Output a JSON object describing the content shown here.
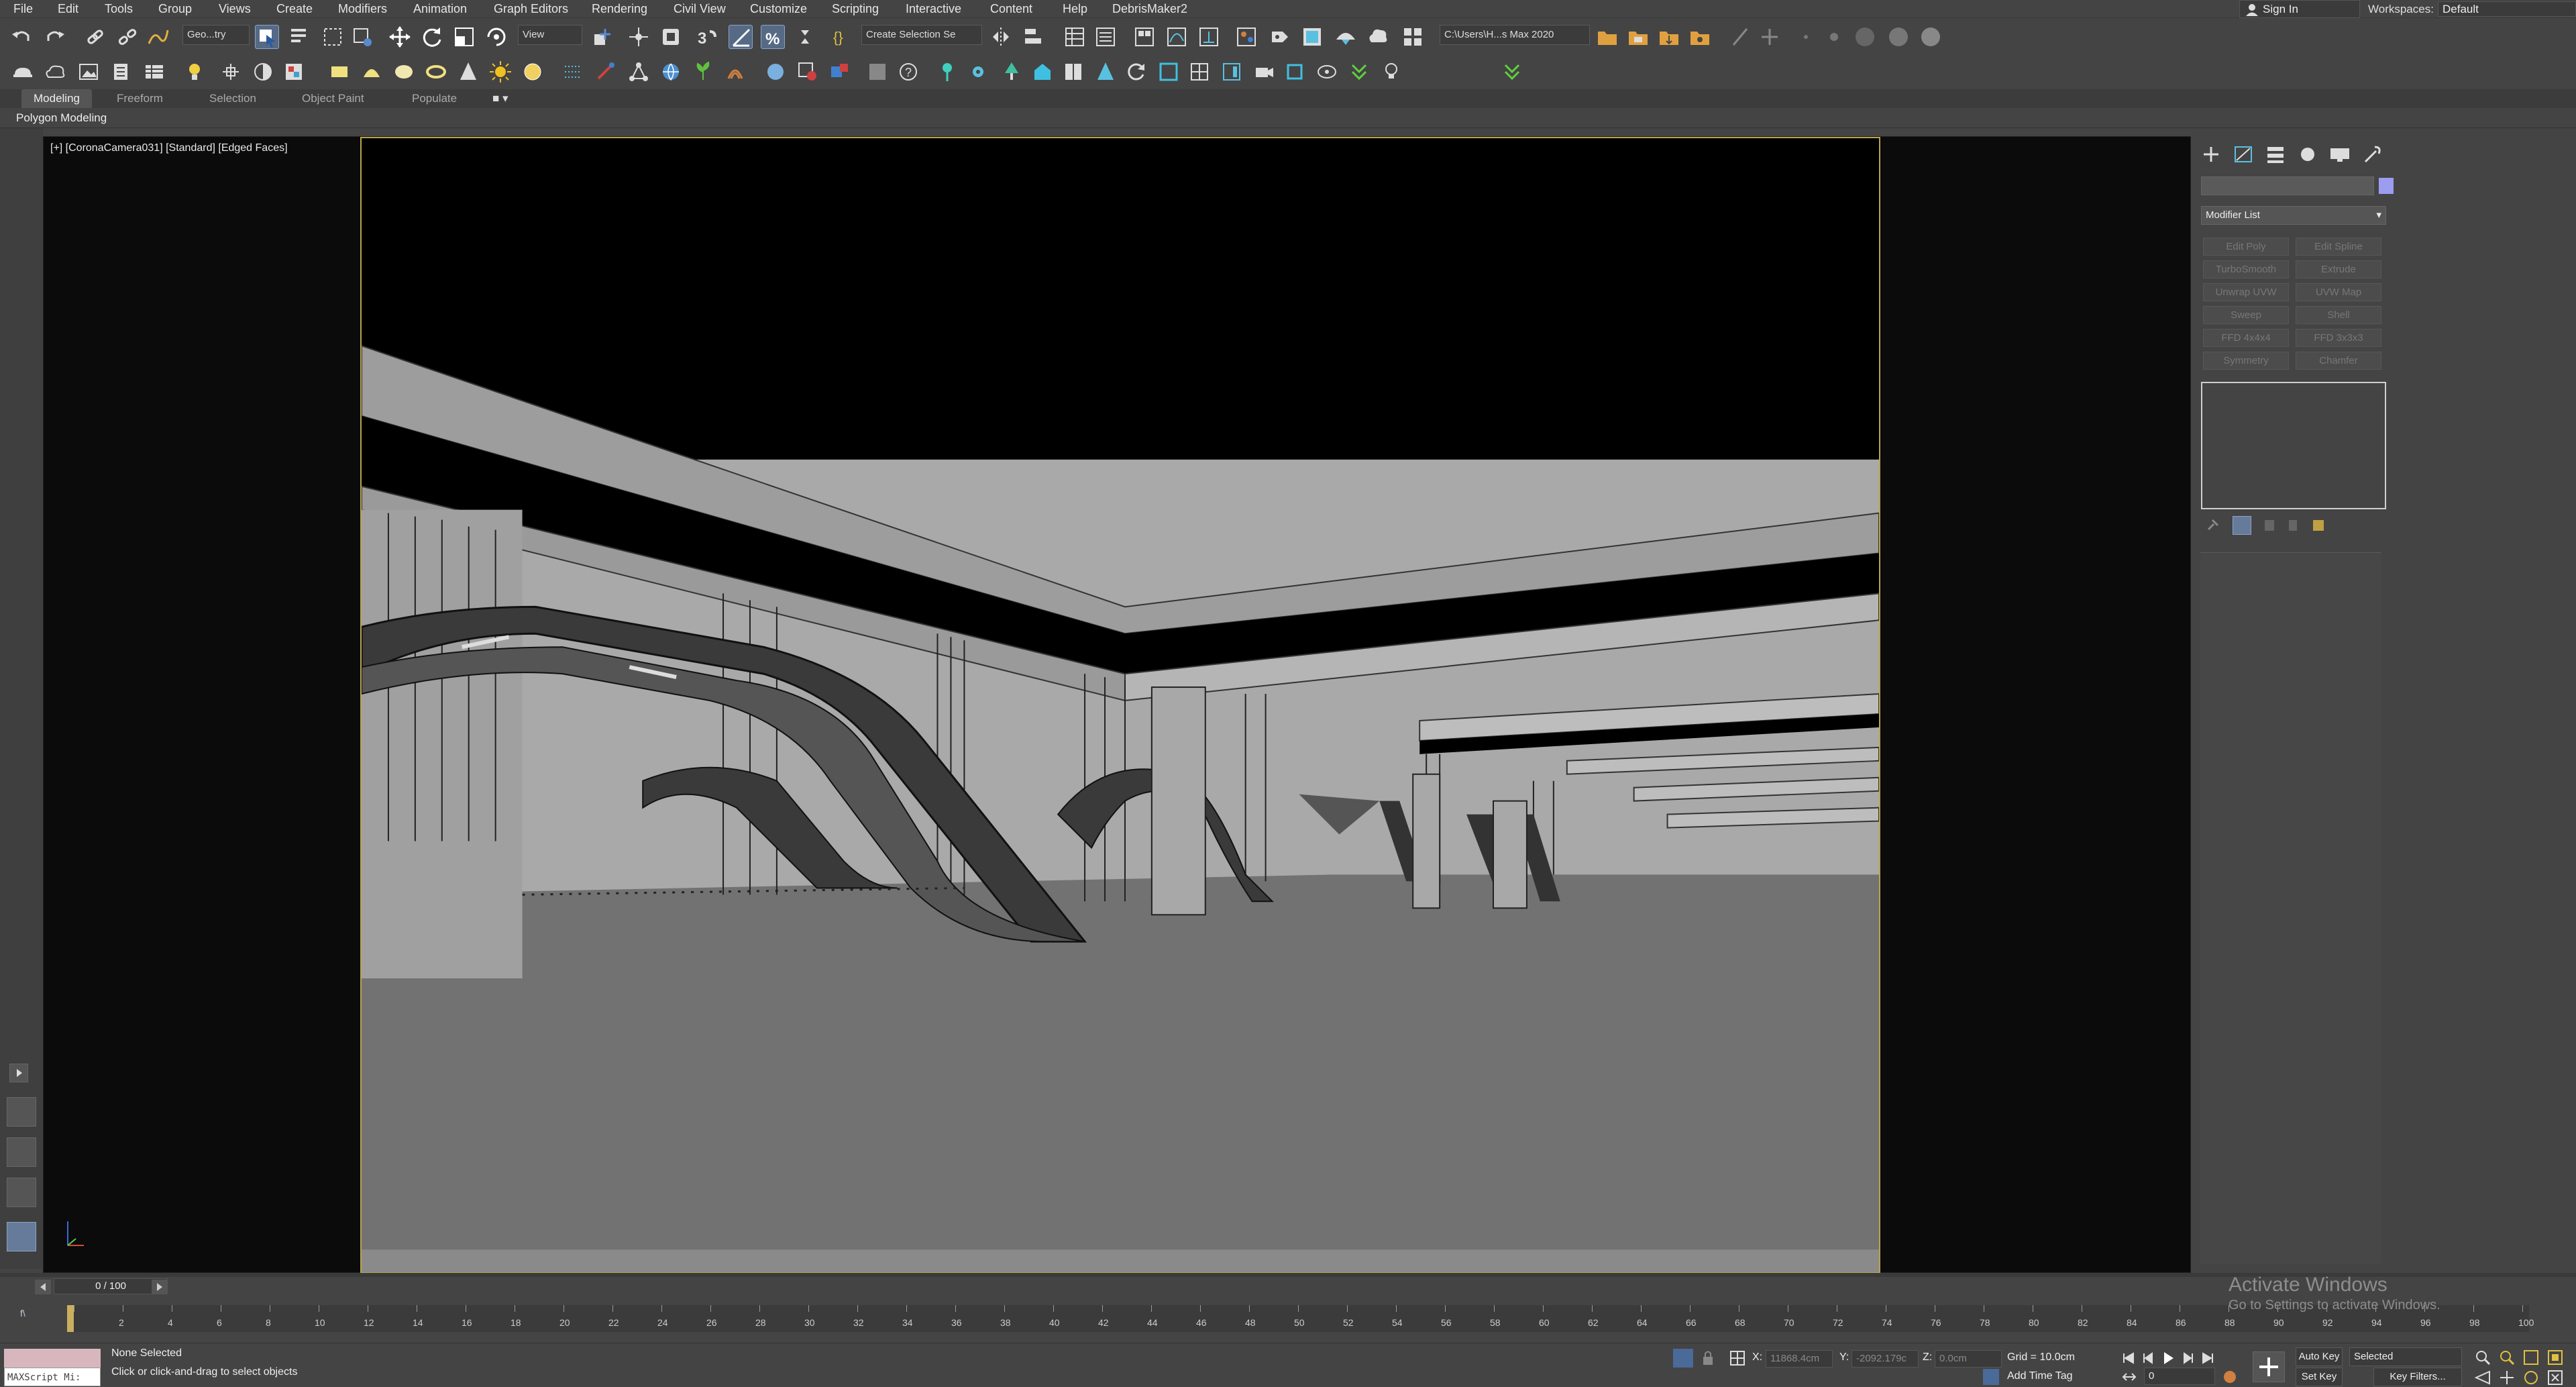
{
  "menubar": {
    "items": [
      "File",
      "Edit",
      "Tools",
      "Group",
      "Views",
      "Create",
      "Modifiers",
      "Animation",
      "Graph Editors",
      "Rendering",
      "Civil View",
      "Customize",
      "Scripting",
      "Interactive",
      "Content",
      "Help",
      "DebrisMaker2"
    ],
    "sign_in": "Sign In",
    "workspaces_label": "Workspaces:",
    "workspaces_value": "Default"
  },
  "toolbar": {
    "selection_filter": "Geo...try",
    "reference_coord": "View",
    "named_selection": "Create Selection Se",
    "project_path": "C:\\Users\\H...s Max 2020"
  },
  "ribbon": {
    "tabs": [
      "Modeling",
      "Freeform",
      "Selection",
      "Object Paint",
      "Populate"
    ],
    "sub_label": "Polygon Modeling"
  },
  "viewport": {
    "label": "[+] [CoronaCamera031] [Standard] [Edged Faces]"
  },
  "command_panel": {
    "modifier_list": "Modifier List",
    "buttons": [
      "Edit Poly",
      "Edit Spline",
      "TurboSmooth",
      "Extrude",
      "Unwrap UVW",
      "UVW Map",
      "Sweep",
      "Shell",
      "FFD 4x4x4",
      "FFD 3x3x3",
      "Symmetry",
      "Chamfer"
    ],
    "color_swatch": "#9c9cf0"
  },
  "timeline": {
    "slider_text": "0 / 100",
    "ticks": [
      "0",
      "2",
      "4",
      "6",
      "8",
      "10",
      "12",
      "14",
      "16",
      "18",
      "20",
      "22",
      "24",
      "26",
      "28",
      "30",
      "32",
      "34",
      "36",
      "38",
      "40",
      "42",
      "44",
      "46",
      "48",
      "50",
      "52",
      "54",
      "56",
      "58",
      "60",
      "62",
      "64",
      "66",
      "68",
      "70",
      "72",
      "74",
      "76",
      "78",
      "80",
      "82",
      "84",
      "86",
      "88",
      "90",
      "92",
      "94",
      "96",
      "98",
      "100"
    ]
  },
  "status": {
    "maxscript_label": "MAXScript Mi:",
    "selection_status": "None Selected",
    "prompt": "Click or click-and-drag to select objects",
    "x_label": "X:",
    "x_value": "11868.4cm",
    "y_label": "Y:",
    "y_value": "-2092.179c",
    "z_label": "Z:",
    "z_value": "0.0cm",
    "grid": "Grid = 10.0cm",
    "add_time_tag": "Add Time Tag",
    "auto_key": "Auto Key",
    "set_key": "Set Key",
    "key_mode": "Selected",
    "key_filters": "Key Filters...",
    "frame_value": "0"
  },
  "watermark": {
    "title": "Activate Windows",
    "subtitle": "Go to Settings to activate Windows."
  }
}
